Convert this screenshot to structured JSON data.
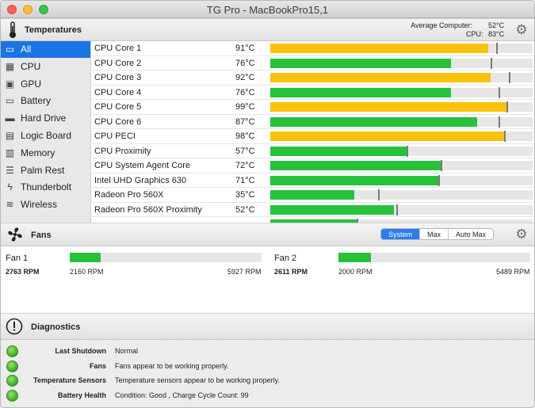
{
  "window": {
    "title": "TG Pro - MacBookPro15,1"
  },
  "temperatures": {
    "section_title": "Temperatures",
    "average_label": "Average Computer:",
    "average_value": "52°C",
    "cpu_label": "CPU:",
    "cpu_value": "83°C",
    "sidebar": [
      {
        "label": "All",
        "icon": "laptop-icon",
        "selected": true
      },
      {
        "label": "CPU",
        "icon": "cpu-icon"
      },
      {
        "label": "GPU",
        "icon": "gpu-icon"
      },
      {
        "label": "Battery",
        "icon": "battery-icon"
      },
      {
        "label": "Hard Drive",
        "icon": "hard-drive-icon"
      },
      {
        "label": "Logic Board",
        "icon": "logic-board-icon"
      },
      {
        "label": "Memory",
        "icon": "memory-icon"
      },
      {
        "label": "Palm Rest",
        "icon": "palm-rest-icon"
      },
      {
        "label": "Thunderbolt",
        "icon": "thunderbolt-icon"
      },
      {
        "label": "Wireless",
        "icon": "wireless-icon"
      }
    ],
    "rows": [
      {
        "name": "CPU Core 1",
        "value": "91°C",
        "fill_pct": 83,
        "marker_pct": 86,
        "color": "#fbc20a"
      },
      {
        "name": "CPU Core 2",
        "value": "76°C",
        "fill_pct": 69,
        "marker_pct": 84,
        "color": "#27c23a"
      },
      {
        "name": "CPU Core 3",
        "value": "92°C",
        "fill_pct": 84,
        "marker_pct": 91,
        "color": "#fbc20a"
      },
      {
        "name": "CPU Core 4",
        "value": "76°C",
        "fill_pct": 69,
        "marker_pct": 87,
        "color": "#27c23a"
      },
      {
        "name": "CPU Core 5",
        "value": "99°C",
        "fill_pct": 90,
        "marker_pct": 90,
        "color": "#fbc20a"
      },
      {
        "name": "CPU Core 6",
        "value": "87°C",
        "fill_pct": 79,
        "marker_pct": 87,
        "color": "#27c23a"
      },
      {
        "name": "CPU PECI",
        "value": "98°C",
        "fill_pct": 89,
        "marker_pct": 89,
        "color": "#fbc20a"
      },
      {
        "name": "CPU Proximity",
        "value": "57°C",
        "fill_pct": 52,
        "marker_pct": 52,
        "color": "#27c23a"
      },
      {
        "name": "CPU System Agent Core",
        "value": "72°C",
        "fill_pct": 65,
        "marker_pct": 65,
        "color": "#27c23a"
      },
      {
        "name": "Intel UHD Graphics 630",
        "value": "71°C",
        "fill_pct": 64,
        "marker_pct": 64,
        "color": "#27c23a"
      },
      {
        "name": "Radeon Pro 560X",
        "value": "35°C",
        "fill_pct": 32,
        "marker_pct": 41,
        "color": "#27c23a"
      },
      {
        "name": "Radeon Pro 560X Proximity",
        "value": "52°C",
        "fill_pct": 47,
        "marker_pct": 48,
        "color": "#27c23a"
      },
      {
        "name": "",
        "value": "",
        "fill_pct": 33,
        "marker_pct": 33,
        "color": "#27c23a"
      }
    ]
  },
  "fans": {
    "section_title": "Fans",
    "modes": [
      {
        "label": "System",
        "active": true
      },
      {
        "label": "Max"
      },
      {
        "label": "Auto Max"
      }
    ],
    "items": [
      {
        "name": "Fan 1",
        "rpm": "2763 RPM",
        "min": "2160 RPM",
        "max": "5927 RPM",
        "fill_pct": 16
      },
      {
        "name": "Fan 2",
        "rpm": "2611 RPM",
        "min": "2000 RPM",
        "max": "5489 RPM",
        "fill_pct": 17
      }
    ]
  },
  "diagnostics": {
    "section_title": "Diagnostics",
    "rows": [
      {
        "label": "Last Shutdown",
        "value": "Normal",
        "status_color": "#3aa720"
      },
      {
        "label": "Fans",
        "value": "Fans appear to be working properly.",
        "status_color": "#3aa720"
      },
      {
        "label": "Temperature Sensors",
        "value": "Temperature sensors appear to be working properly.",
        "status_color": "#3aa720"
      },
      {
        "label": "Battery Health",
        "value": "Condition: Good , Charge Cycle Count: 99",
        "status_color": "#3aa720"
      }
    ]
  }
}
